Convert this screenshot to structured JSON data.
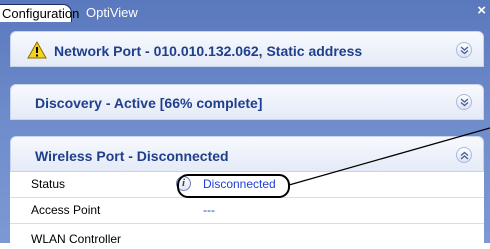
{
  "tabs": {
    "active": "Configuration",
    "inactive": "OptiView",
    "close": "×"
  },
  "sections": {
    "network": {
      "title": "Network Port - 010.010.132.062, Static address"
    },
    "discovery": {
      "title": "Discovery - Active [66% complete]",
      "progress_percent": 66
    },
    "wireless": {
      "title": "Wireless Port - Disconnected"
    }
  },
  "wireless_table": [
    {
      "label": "Status",
      "value": "Disconnected",
      "info_icon": "i"
    },
    {
      "label": "Access Point",
      "value": "---"
    },
    {
      "label": "WLAN Controller",
      "value": ""
    }
  ],
  "icons": {
    "warning": "warning-icon",
    "chevron_down": "chevron-down-icon",
    "chevron_up": "chevron-up-icon",
    "info": "info-icon"
  },
  "colors": {
    "header_bg": "#5a78bd",
    "section_title": "#1f3f8d",
    "link": "#1f3fd6"
  }
}
